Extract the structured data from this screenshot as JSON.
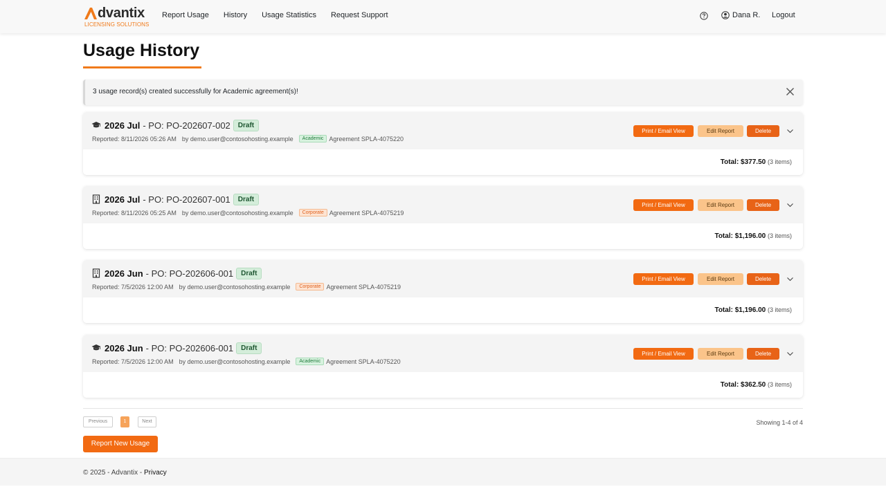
{
  "brand": {
    "name": "dvantix",
    "subtitle": "LICENSING SOLUTIONS",
    "accent": "#f07a1a"
  },
  "nav": {
    "links": [
      "Report Usage",
      "History",
      "Usage Statistics",
      "Request Support"
    ],
    "user": "Dana R.",
    "logout": "Logout"
  },
  "page": {
    "title": "Usage History"
  },
  "alert": {
    "message": "3 usage record(s) created successfully for Academic agreement(s)!"
  },
  "actions": {
    "print": "Print / Email View",
    "edit": "Edit Report",
    "delete": "Delete"
  },
  "records": [
    {
      "icon": "graduation-cap-icon",
      "period": "2026 Jul",
      "po": "- PO: PO-202607-002",
      "status": "Draft",
      "reported": "Reported: 8/11/2026 05:26 AM",
      "by": "by demo.user@contosohosting.example",
      "tag": "Academic",
      "agreement": "Agreement SPLA-4075220",
      "total_label": "Total: $377.50",
      "items": "(3 items)"
    },
    {
      "icon": "building-icon",
      "period": "2026 Jul",
      "po": "- PO: PO-202607-001",
      "status": "Draft",
      "reported": "Reported: 8/11/2026 05:25 AM",
      "by": "by demo.user@contosohosting.example",
      "tag": "Corporate",
      "agreement": "Agreement SPLA-4075219",
      "total_label": "Total: $1,196.00",
      "items": "(3 items)"
    },
    {
      "icon": "building-icon",
      "period": "2026 Jun",
      "po": "- PO: PO-202606-001",
      "status": "Draft",
      "reported": "Reported: 7/5/2026 12:00 AM",
      "by": "by demo.user@contosohosting.example",
      "tag": "Corporate",
      "agreement": "Agreement SPLA-4075219",
      "total_label": "Total: $1,196.00",
      "items": "(3 items)"
    },
    {
      "icon": "graduation-cap-icon",
      "period": "2026 Jun",
      "po": "- PO: PO-202606-001",
      "status": "Draft",
      "reported": "Reported: 7/5/2026 12:00 AM",
      "by": "by demo.user@contosohosting.example",
      "tag": "Academic",
      "agreement": "Agreement SPLA-4075220",
      "total_label": "Total: $362.50",
      "items": "(3 items)"
    }
  ],
  "pagination": {
    "previous": "Previous",
    "current": "1",
    "next": "Next",
    "showing": "Showing 1-4 of 4"
  },
  "report_new": "Report New Usage",
  "footer": {
    "text": "© 2025 - Advantix - ",
    "privacy": "Privacy"
  }
}
